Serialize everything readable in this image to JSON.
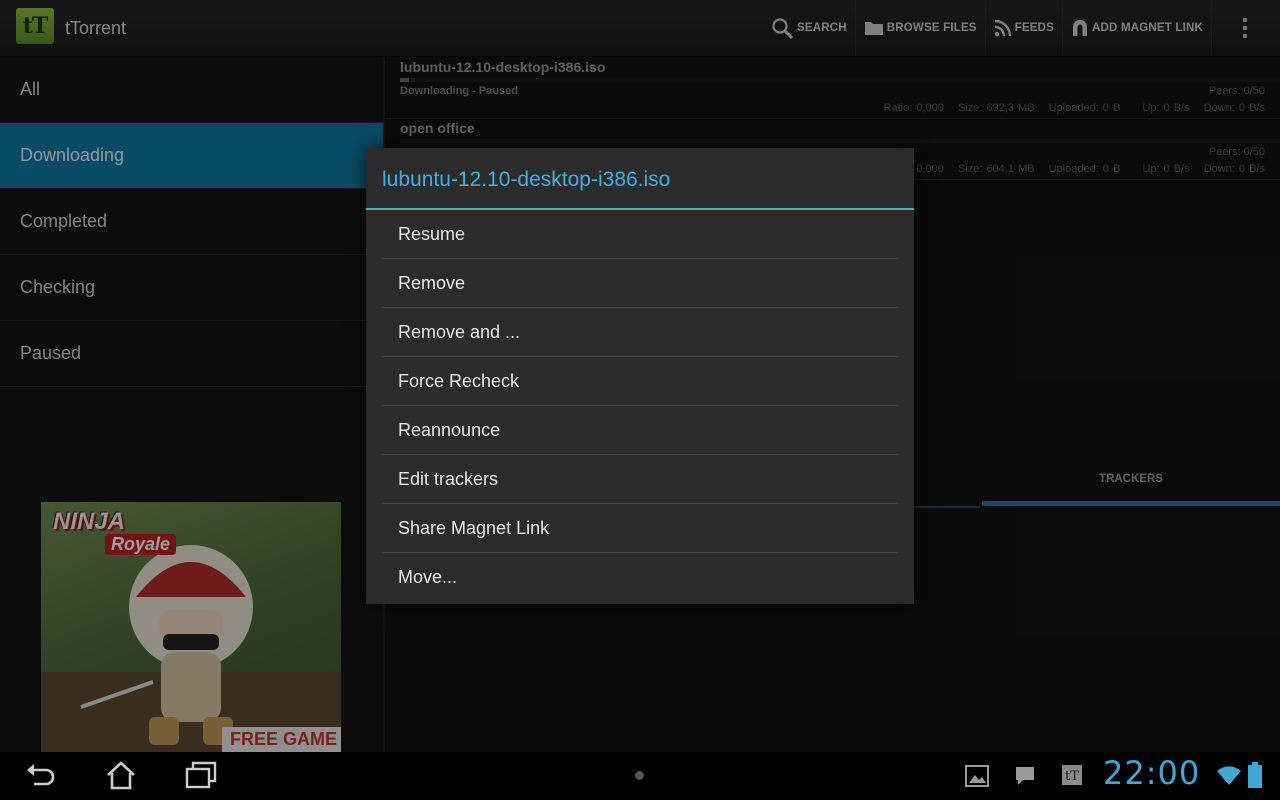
{
  "app": {
    "icon_text": "tT",
    "title": "tTorrent"
  },
  "actions": [
    {
      "label": "SEARCH",
      "icon": "search-icon"
    },
    {
      "label": "BROWSE FILES",
      "icon": "folder-icon"
    },
    {
      "label": "FEEDS",
      "icon": "rss-icon"
    },
    {
      "label": "ADD MAGNET LINK",
      "icon": "magnet-icon"
    }
  ],
  "sidebar": {
    "items": [
      {
        "label": "All"
      },
      {
        "label": "Downloading",
        "active": true
      },
      {
        "label": "Completed"
      },
      {
        "label": "Checking"
      },
      {
        "label": "Paused"
      }
    ]
  },
  "ad": {
    "title": "NINJA",
    "subtitle": "Royale",
    "cta": "FREE GAME"
  },
  "torrents": [
    {
      "name": "lubuntu-12.10-desktop-i386.iso",
      "progress": 0.01,
      "status": "Downloading - Paused",
      "peers": "Peers: 0/50",
      "ratio": "Ratio: 0,000",
      "size": "Size: 692,3 MB",
      "uploaded": "Uploaded: 0 B",
      "up": "Up: 0 B/s",
      "down": "Down: 0 B/s"
    },
    {
      "name": "open office",
      "progress": 0.0,
      "status": "",
      "peers": "Peers: 0/50",
      "ratio": "Ratio: 0,000",
      "size": "Size: 604,1 MB",
      "uploaded": "Uploaded: 0 B",
      "up": "Up: 0 B/s",
      "down": "Down: 0 B/s"
    }
  ],
  "detail_tabs": {
    "trackers": "TRACKERS"
  },
  "dialog": {
    "title": "lubuntu-12.10-desktop-i386.iso",
    "items": [
      {
        "label": "Resume"
      },
      {
        "label": "Remove"
      },
      {
        "label": "Remove and ..."
      },
      {
        "label": "Force Recheck"
      },
      {
        "label": "Reannounce"
      },
      {
        "label": "Edit trackers"
      },
      {
        "label": "Share Magnet Link"
      },
      {
        "label": "Move..."
      }
    ]
  },
  "system_bar": {
    "clock": "22:00",
    "notif_app_icon_text": "tT"
  },
  "colors": {
    "accent": "#33b5e5",
    "selected": "#0f7aa3"
  }
}
